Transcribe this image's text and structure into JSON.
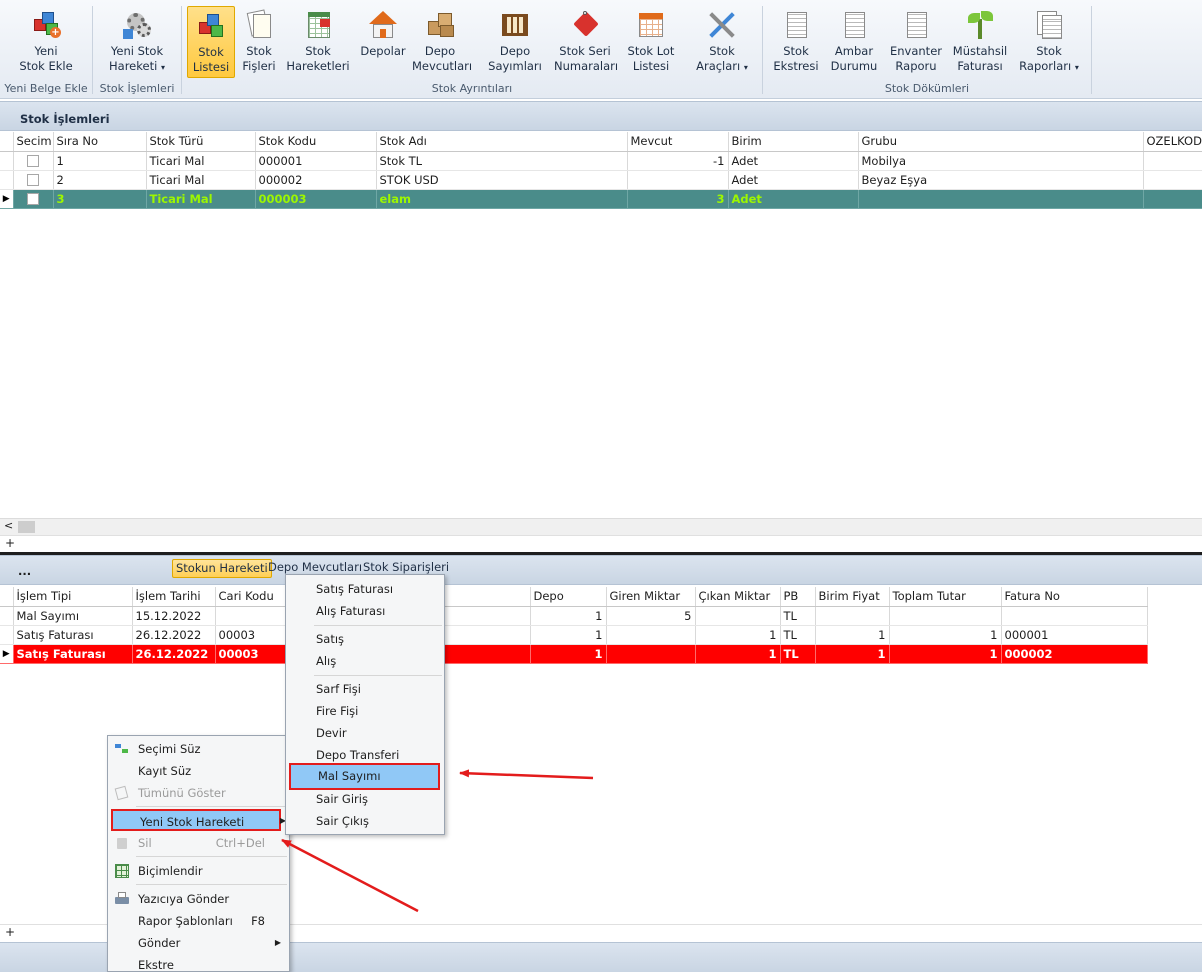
{
  "ribbon": {
    "groups": [
      {
        "label": "Yeni Belge Ekle",
        "buttons": [
          {
            "line1": "Yeni",
            "line2": "Stok Ekle"
          }
        ]
      },
      {
        "label": "Stok İşlemleri",
        "buttons": [
          {
            "line1": "Yeni Stok",
            "line2": "Hareketi"
          }
        ]
      },
      {
        "label": "Stok Ayrıntıları",
        "buttons": [
          {
            "line1": "Stok",
            "line2": "Listesi"
          },
          {
            "line1": "Stok",
            "line2": "Fişleri"
          },
          {
            "line1": "Stok",
            "line2": "Hareketleri"
          },
          {
            "line1": "Depolar",
            "line2": ""
          },
          {
            "line1": "Depo",
            "line2": "Mevcutları"
          },
          {
            "line1": "Depo",
            "line2": "Sayımları"
          },
          {
            "line1": "Stok Seri",
            "line2": "Numaraları"
          },
          {
            "line1": "Stok Lot",
            "line2": "Listesi"
          },
          {
            "line1": "Stok",
            "line2": "Araçları"
          }
        ]
      },
      {
        "label": "Stok Dökümleri",
        "buttons": [
          {
            "line1": "Stok",
            "line2": "Ekstresi"
          },
          {
            "line1": "Ambar",
            "line2": "Durumu"
          },
          {
            "line1": "Envanter",
            "line2": "Raporu"
          },
          {
            "line1": "Müstahsil",
            "line2": "Faturası"
          },
          {
            "line1": "Stok",
            "line2": "Raporları"
          }
        ]
      }
    ]
  },
  "top_panel": {
    "title": "Stok İşlemleri",
    "columns": [
      "Secim",
      "Sıra No",
      "Stok Türü",
      "Stok Kodu",
      "Stok Adı",
      "Mevcut",
      "Birim",
      "Grubu",
      "OZELKOD1"
    ],
    "rows": [
      {
        "sira": "1",
        "tur": "Ticari Mal",
        "kod": "000001",
        "ad": "Stok TL",
        "mevcut": "-1",
        "birim": "Adet",
        "grup": "Mobilya"
      },
      {
        "sira": "2",
        "tur": "Ticari Mal",
        "kod": "000002",
        "ad": "STOK USD",
        "mevcut": "",
        "birim": "Adet",
        "grup": "Beyaz Eşya"
      },
      {
        "sira": "3",
        "tur": "Ticari Mal",
        "kod": "000003",
        "ad": "elam",
        "mevcut": "3",
        "birim": "Adet",
        "grup": ""
      }
    ],
    "scroll_left": "<",
    "add": "+"
  },
  "bottom_panel": {
    "ellipsis": "...",
    "tabs": [
      "Stokun Hareketi",
      "Depo Mevcutları",
      "Stok Siparişleri"
    ],
    "columns": [
      "İşlem Tipi",
      "İşlem Tarihi",
      "Cari Kodu",
      "Depo",
      "Giren Miktar",
      "Çıkan Miktar",
      "PB",
      "Birim Fiyat",
      "Toplam Tutar",
      "Fatura No"
    ],
    "rows": [
      {
        "tip": "Mal Sayımı",
        "tarih": "15.12.2022",
        "cari": "",
        "depo": "1",
        "giren": "5",
        "cikan": "",
        "pb": "TL",
        "fiyat": "",
        "tutar": "",
        "fatura": ""
      },
      {
        "tip": "Satış Faturası",
        "tarih": "26.12.2022",
        "cari": "00003",
        "depo": "1",
        "giren": "",
        "cikan": "1",
        "pb": "TL",
        "fiyat": "1",
        "tutar": "1",
        "fatura": "000001"
      },
      {
        "tip": "Satış Faturası",
        "tarih": "26.12.2022",
        "cari": "00003",
        "depo": "1",
        "giren": "",
        "cikan": "1",
        "pb": "TL",
        "fiyat": "1",
        "tutar": "1",
        "fatura": "000002"
      }
    ],
    "add": "+"
  },
  "context_menu": {
    "items": [
      "Seçimi Süz",
      "Kayıt Süz",
      "Tümünü Göster",
      "Yeni Stok Hareketi",
      "Sil",
      "Biçimlendir",
      "Yazıcıya Gönder",
      "Rapor Şablonları",
      "Gönder",
      "Ekstre"
    ],
    "shortcuts": {
      "sil": "Ctrl+Del",
      "rapor": "F8"
    }
  },
  "submenu": {
    "items": [
      "Satış Faturası",
      "Alış Faturası",
      "Satış",
      "Alış",
      "Sarf Fişi",
      "Fire Fişi",
      "Devir",
      "Depo Transferi",
      "Mal Sayımı",
      "Sair Giriş",
      "Sair Çıkış"
    ]
  },
  "colors": {
    "selected_row_green": "#4a8c8a",
    "selected_row_red": "#ff0000",
    "annotation": "#e31c1c",
    "highlight": "#90c8f6"
  }
}
